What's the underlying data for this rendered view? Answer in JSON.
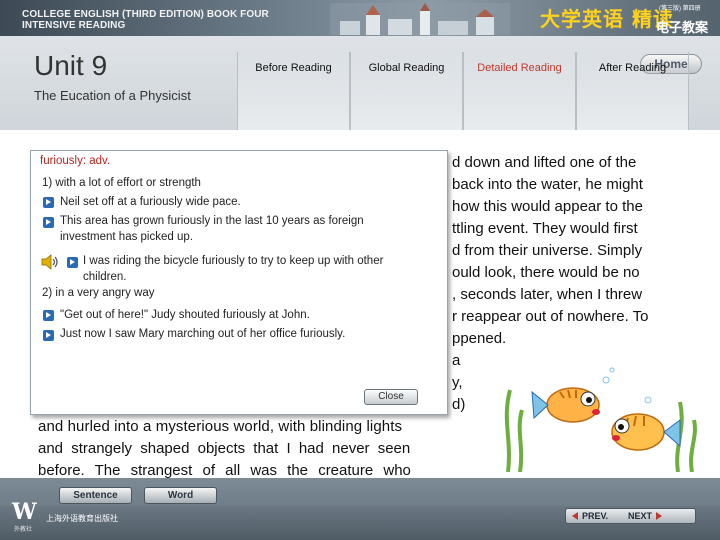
{
  "banner": {
    "book_line1": "COLLEGE ENGLISH (THIRD EDITION) BOOK FOUR",
    "book_line2": "INTENSIVE READING",
    "brand": "大学英语 精读",
    "brand_edition": "(第三版) 第四册",
    "brand_sub": "电子教案"
  },
  "header": {
    "unit_title": "Unit 9",
    "unit_subtitle": "The Eucation of a Physicist",
    "home_label": "Home"
  },
  "tabs": [
    {
      "label": "Before Reading",
      "active": false
    },
    {
      "label": "Global Reading",
      "active": false
    },
    {
      "label": "Detailed Reading",
      "active": true
    },
    {
      "label": "After Reading",
      "active": false
    }
  ],
  "reading_lines": [
    "d down and lifted one of the",
    "back into the water, he might",
    "how this would appear to the",
    "ttling event. They would first",
    "d from their universe. Simply",
    "ould look, there would be no",
    ", seconds later, when I threw",
    "r reappear out of nowhere. To",
    "ppened.",
    "a",
    "y,",
    "d)",
    "and hurled into a mysterious world, with blinding lights",
    "and strangely shaped objects that I had never seen",
    "before. The strangest of all was the creature who"
  ],
  "popup": {
    "headword": "furiously:  adv.",
    "sense1": "1) with a lot of effort or strength",
    "ex1": "Neil set off at a furiously wide pace.",
    "ex2_line1": "This area has grown furiously in the last 10 years as foreign",
    "ex2_line2": "investment has picked up.",
    "ex3_line1": "I was riding the bicycle furiously to try to keep up with other",
    "ex3_line2": "children.",
    "sense2": "2) in a very angry way",
    "ex4": "\"Get out of here!\" Judy shouted furiously at John.",
    "ex5": "Just now I saw Mary marching out of her office furiously.",
    "close_label": "Close"
  },
  "footer": {
    "logo_caption": "外教社",
    "publisher": "上海外语教育出版社",
    "sentence_label": "Sentence",
    "word_label": "Word",
    "prev_label": "PREV.",
    "next_label": "NEXT"
  },
  "colors": {
    "active_tab": "#c0392b",
    "brand_yellow": "#ffd21e",
    "bullet_blue": "#2a6ab3",
    "headword_red": "#b3261e"
  }
}
